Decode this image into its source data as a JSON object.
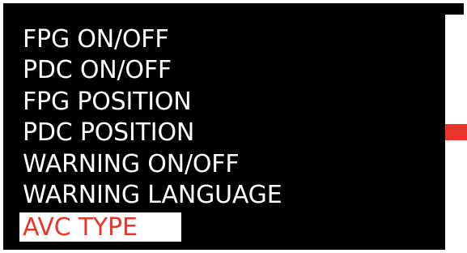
{
  "accent_color": "#e8372a",
  "menu": {
    "items": [
      {
        "label": "FPG ON/OFF",
        "selected": false
      },
      {
        "label": "PDC ON/OFF",
        "selected": false
      },
      {
        "label": "FPG POSITION",
        "selected": false
      },
      {
        "label": "PDC POSITION",
        "selected": false
      },
      {
        "label": "WARNING ON/OFF",
        "selected": false
      },
      {
        "label": "WARNING LANGUAGE",
        "selected": false
      },
      {
        "label": "AVC TYPE",
        "selected": true
      }
    ]
  },
  "scrollbar": {
    "position_fraction": 0.5,
    "thumb_fraction": 0.07
  }
}
